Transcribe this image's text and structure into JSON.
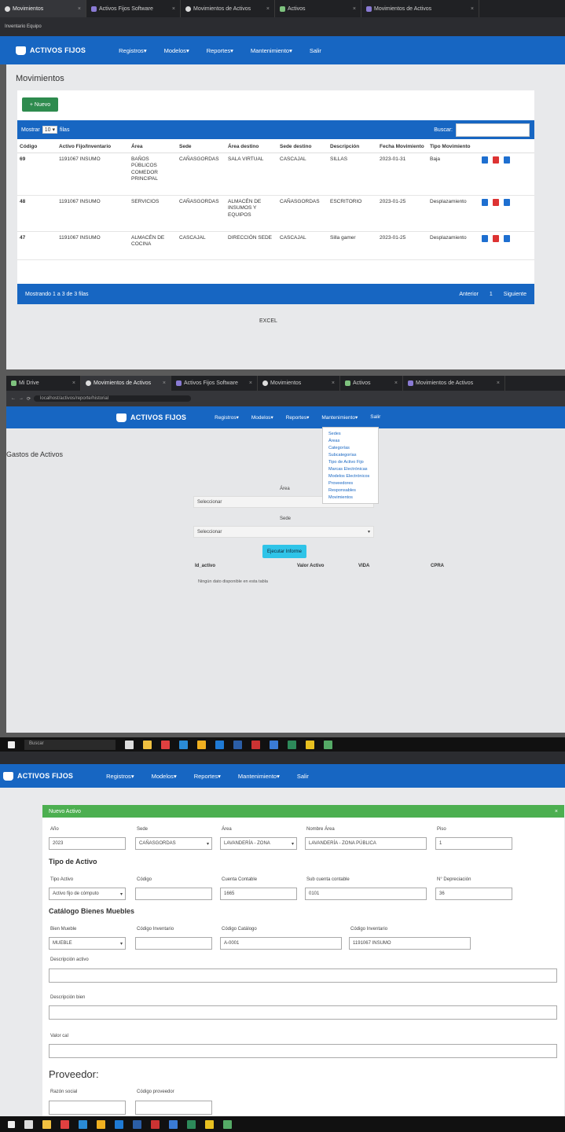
{
  "top": {
    "tabs": [
      {
        "label": "Movimientos"
      },
      {
        "label": "Activos Fijos Software"
      },
      {
        "label": "Movimientos de Activos"
      },
      {
        "label": "Activos"
      },
      {
        "label": "Movimientos de Activos"
      }
    ],
    "bookmark": "Inventario Equipo",
    "brand": "ACTIVOS FIJOS",
    "nav": [
      "Registros",
      "Modelos",
      "Reportes",
      "Mantenimiento",
      "Salir"
    ],
    "title": "Movimientos",
    "new_button": "+ Nuevo",
    "show_label": "Mostrar",
    "show_value": "10",
    "entries_label": "filas",
    "search_label": "Buscar:",
    "columns": [
      "Código",
      "Activo Fijo/Inventario",
      "Área",
      "Sede",
      "Área destino",
      "Sede destino",
      "Descripción",
      "Fecha Movimiento",
      "Tipo Movimiento"
    ],
    "rows": [
      {
        "id": "69",
        "activo": "1191067 INSUMO",
        "area": "BAÑOS PÚBLICOS COMEDOR PRINCIPAL",
        "sede": "CAÑASGORDAS",
        "area_d": "SALA VIRTUAL",
        "sede_d": "CASCAJAL",
        "desc": "SILLAS",
        "fecha": "2023-01-31",
        "tipo": "Baja"
      },
      {
        "id": "48",
        "activo": "1191067 INSUMO",
        "area": "SERVICIOS",
        "sede": "CAÑASGORDAS",
        "area_d": "ALMACÉN DE INSUMOS Y EQUIPOS",
        "sede_d": "CAÑASGORDAS",
        "desc": "ESCRITORIO",
        "fecha": "2023-01-25",
        "tipo": "Desplazamiento"
      },
      {
        "id": "47",
        "activo": "1191067 INSUMO",
        "area": "ALMACÉN DE COCINA",
        "sede": "CASCAJAL",
        "area_d": "DIRECCIÓN SEDE",
        "sede_d": "CASCAJAL",
        "desc": "Silla gamer",
        "fecha": "2023-01-25",
        "tipo": "Desplazamiento"
      }
    ],
    "footer_info": "Mostrando 1 a 3 de 3 filas",
    "prev": "Anterior",
    "page": "1",
    "next": "Siguiente",
    "extra": "EXCEL"
  },
  "middle": {
    "tabs": [
      {
        "label": "Mi Drive"
      },
      {
        "label": "Movimientos de Activos"
      },
      {
        "label": "Activos Fijos Software"
      },
      {
        "label": "Movimientos"
      },
      {
        "label": "Activos"
      },
      {
        "label": "Movimientos de Activos"
      }
    ],
    "url": "localhost/activos/reporte/historial",
    "brand": "ACTIVOS FIJOS",
    "nav": [
      "Registros",
      "Modelos",
      "Reportes",
      "Mantenimiento",
      "Salir"
    ],
    "title": "Gastos de Activos",
    "label1": "Área",
    "select1": "Seleccionar",
    "label2": "Sede",
    "select2": "Seleccionar",
    "dropdown": [
      "Sedes",
      "Áreas",
      "Categorías",
      "Subcategorías",
      "Tipo de Activo Fijo",
      "Marcas Electrónicas",
      "Modelos Electrónicos",
      "Proveedores",
      "Responsables",
      "Movimientos"
    ],
    "button": "Ejecutar Informe",
    "cols": [
      "Id_activo",
      "Valor Activo",
      "VIDA",
      "CPRA"
    ],
    "empty": "Ningún dato disponible en esta tabla",
    "taskbar_search": "Buscar"
  },
  "bottom": {
    "brand": "ACTIVOS FIJOS",
    "nav": [
      "Registros",
      "Modelos",
      "Reportes",
      "Mantenimiento",
      "Salir"
    ],
    "form_title": "Nuevo Activo",
    "fields_row1": [
      {
        "label": "Año",
        "value": "2023"
      },
      {
        "label": "Sede",
        "value": "CAÑASGORDAS"
      },
      {
        "label": "Área",
        "value": "LAVANDERÍA - ZONA"
      },
      {
        "label": "Nombre Área",
        "value": "LAVANDERÍA - ZONA PÚBLICA"
      },
      {
        "label": "Piso",
        "value": "1"
      }
    ],
    "section_tipo": "Tipo de Activo",
    "fields_row2": [
      {
        "label": "Tipo Activo",
        "value": "Activo fijo de cómputo"
      },
      {
        "label": "Código",
        "value": ""
      },
      {
        "label": "Cuenta Contable",
        "value": "1665"
      },
      {
        "label": "Sub cuenta contable",
        "value": "0101"
      },
      {
        "label": "N° Depreciación",
        "value": "36"
      }
    ],
    "section_catalogo": "Catálogo Bienes Muebles",
    "fields_row3": [
      {
        "label": "Bien Mueble",
        "value": "MUEBLE"
      },
      {
        "label": "Código Inventario",
        "value": ""
      },
      {
        "label": "Código Catálogo",
        "value": "A-0001"
      },
      {
        "label": "Código Inventario",
        "value": "1191067 INSUMO"
      }
    ],
    "desc_activo": "Descripción activo",
    "desc_bien": "Descripción bien",
    "valor": "Valor cal",
    "section_prov": "Proveedor:",
    "prov_fields": [
      {
        "label": "Razón social",
        "value": ""
      },
      {
        "label": "Código proveedor",
        "value": ""
      }
    ]
  },
  "colors": {
    "primary": "#1766c2",
    "success": "#2e8b4e",
    "cyan": "#2fc4e8",
    "green_header": "#4caf50"
  }
}
